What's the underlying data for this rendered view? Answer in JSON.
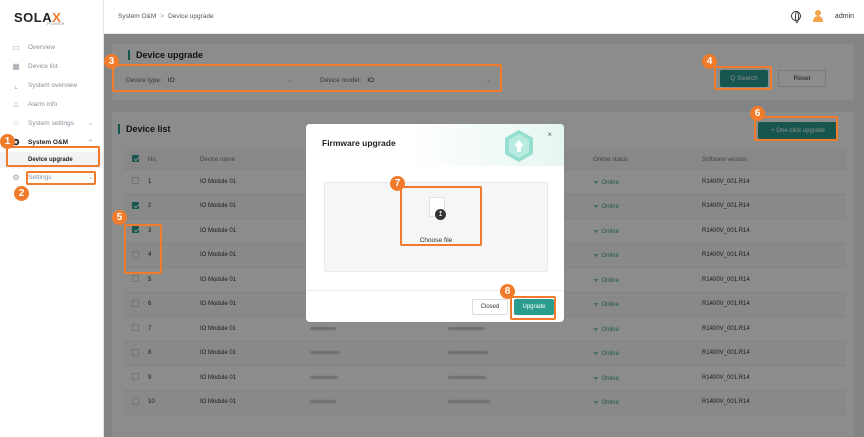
{
  "app": {
    "logo_main": "SOLA",
    "logo_x": "X",
    "logo_sub": "POWER"
  },
  "topbar": {
    "breadcrumb_1": "System O&M",
    "breadcrumb_sep": ">",
    "breadcrumb_2": "Device upgrade",
    "user": "admin"
  },
  "sidebar": {
    "items": [
      {
        "label": "Overview",
        "icon": "monitor-icon"
      },
      {
        "label": "Device list",
        "icon": "grid-icon"
      },
      {
        "label": "System overview",
        "icon": "chart-icon"
      },
      {
        "label": "Alarm info",
        "icon": "alarm-icon"
      },
      {
        "label": "System settings",
        "icon": "settings-grid-icon"
      },
      {
        "label": "System O&M",
        "icon": "wrench-icon"
      },
      {
        "label": "Settings",
        "icon": "gear-icon"
      }
    ],
    "sub_active": "Device upgrade"
  },
  "filter": {
    "title": "Device upgrade",
    "type_label": "Device type:",
    "type_value": "IO",
    "model_label": "Device model:",
    "model_value": "IO",
    "search_label": "Q Search",
    "reset_label": "Reset"
  },
  "list": {
    "title": "Device list",
    "oneclick_label": "+ One-click upgrade",
    "columns": [
      "No.",
      "Device name",
      "",
      "",
      "Online status",
      "Software version"
    ],
    "rows": [
      {
        "no": "1",
        "name": "IO Module 01",
        "status": "Online",
        "version": "R1400V_001.R14",
        "checked": false
      },
      {
        "no": "2",
        "name": "IO Module 01",
        "status": "Online",
        "version": "R1400V_001.R14",
        "checked": true
      },
      {
        "no": "3",
        "name": "IO Module 01",
        "status": "Online",
        "version": "R1400V_001.R14",
        "checked": true
      },
      {
        "no": "4",
        "name": "IO Module 01",
        "status": "Online",
        "version": "R1400V_001.R14",
        "checked": false
      },
      {
        "no": "5",
        "name": "IO Module 01",
        "status": "Online",
        "version": "R1400V_001.R14",
        "checked": false
      },
      {
        "no": "6",
        "name": "IO Module 01",
        "status": "Online",
        "version": "R1400V_001.R14",
        "checked": false
      },
      {
        "no": "7",
        "name": "IO Module 01",
        "status": "Online",
        "version": "R1400V_001.R14",
        "checked": false
      },
      {
        "no": "8",
        "name": "IO Module 01",
        "status": "Online",
        "version": "R1400V_001.R14",
        "checked": false
      },
      {
        "no": "9",
        "name": "IO Module 01",
        "status": "Online",
        "version": "R1400V_001.R14",
        "checked": false
      },
      {
        "no": "10",
        "name": "IO Module 01",
        "status": "Online",
        "version": "R1400V_001.R14",
        "checked": false
      }
    ]
  },
  "modal": {
    "title": "Firmware upgrade",
    "choose_file": "Choose file",
    "closed_label": "Closed",
    "upgrade_label": "Upgrade"
  },
  "annotations": [
    "1",
    "2",
    "3",
    "4",
    "5",
    "6",
    "7",
    "8"
  ],
  "colors": {
    "accent": "#2a9d8f",
    "highlight": "#f07c2b",
    "online": "#3aa57d"
  }
}
